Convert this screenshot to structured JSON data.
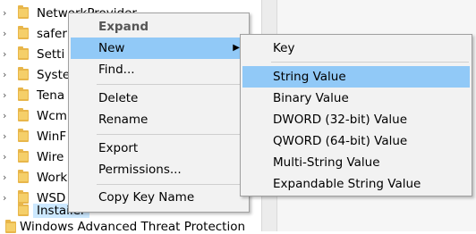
{
  "tree": {
    "items": [
      {
        "label": "NetworkProvider"
      },
      {
        "label": "safer"
      },
      {
        "label": "Setti"
      },
      {
        "label": "Syste"
      },
      {
        "label": "Tena"
      },
      {
        "label": "Wcm"
      },
      {
        "label": "WinF"
      },
      {
        "label": "Wire"
      },
      {
        "label": "Work"
      },
      {
        "label": "WSD"
      },
      {
        "label": "Instailer"
      }
    ],
    "partial_item": "Windows Advanced Threat Protection"
  },
  "context_menu": {
    "expand": "Expand",
    "new": "New",
    "find": "Find...",
    "delete": "Delete",
    "rename": "Rename",
    "export": "Export",
    "permissions": "Permissions...",
    "copy_key_name": "Copy Key Name"
  },
  "new_submenu": {
    "items": [
      {
        "label": "Key"
      },
      {
        "label": "String Value"
      },
      {
        "label": "Binary Value"
      },
      {
        "label": "DWORD (32-bit) Value"
      },
      {
        "label": "QWORD (64-bit) Value"
      },
      {
        "label": "Multi-String Value"
      },
      {
        "label": "Expandable String Value"
      }
    ]
  }
}
